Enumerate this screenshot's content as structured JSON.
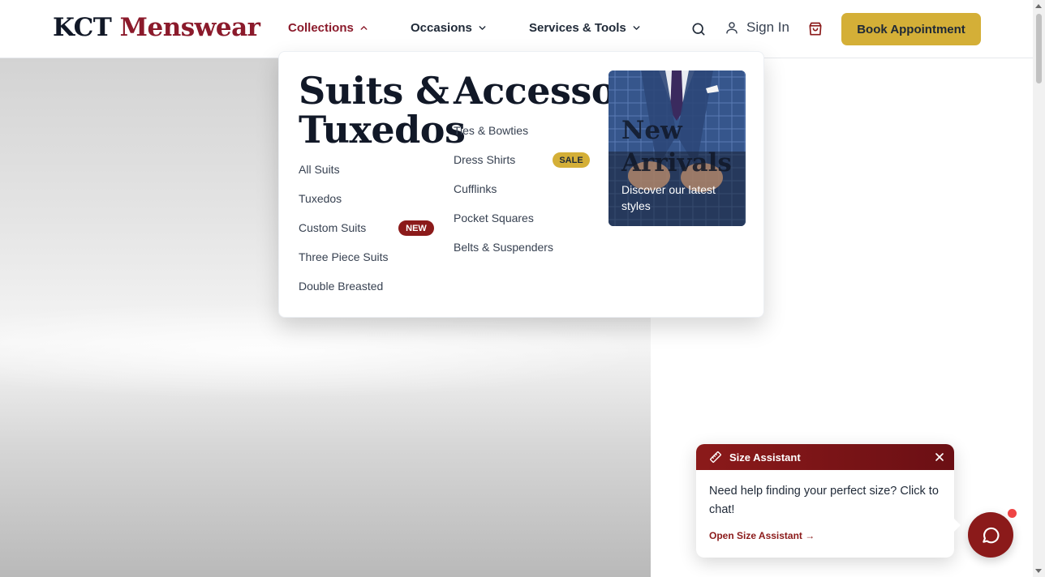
{
  "brand": {
    "part1": "KCT",
    "part2": "Menswear",
    "accent": "#8b1a2b"
  },
  "nav": {
    "items": [
      {
        "label": "Collections",
        "icon": "chevron-up-icon",
        "active": true
      },
      {
        "label": "Occasions",
        "icon": "chevron-down-icon",
        "active": false
      },
      {
        "label": "Services & Tools",
        "icon": "chevron-down-icon",
        "active": false
      }
    ],
    "search_icon": "search-icon",
    "sign_in_label": "Sign In",
    "cart_icon": "shopping-bag-icon",
    "book_label": "Book Appointment",
    "book_color": "#d4af37"
  },
  "mega_menu": {
    "suits": {
      "title_line1": "Suits &",
      "title_line2": "Tuxedos",
      "links": [
        {
          "label": "All Suits"
        },
        {
          "label": "Tuxedos"
        },
        {
          "label": "Custom Suits",
          "badge": "NEW"
        },
        {
          "label": "Three Piece Suits"
        },
        {
          "label": "Double Breasted"
        }
      ]
    },
    "accessories": {
      "title": "Accessories",
      "links": [
        {
          "label": "Ties & Bowties"
        },
        {
          "label": "Dress Shirts",
          "badge": "SALE"
        },
        {
          "label": "Cufflinks"
        },
        {
          "label": "Pocket Squares"
        },
        {
          "label": "Belts & Suspenders"
        }
      ]
    },
    "promo": {
      "title_line1": "New",
      "title_line2": "Arrivals",
      "subtitle": "Discover our latest styles"
    }
  },
  "size_assistant": {
    "title": "Size Assistant",
    "message": "Need help finding your perfect size? Click to chat!",
    "link": "Open Size Assistant →",
    "header_color": "#8b1a1a"
  },
  "chat": {
    "icon": "chat-bubble-icon",
    "has_notification": true
  }
}
